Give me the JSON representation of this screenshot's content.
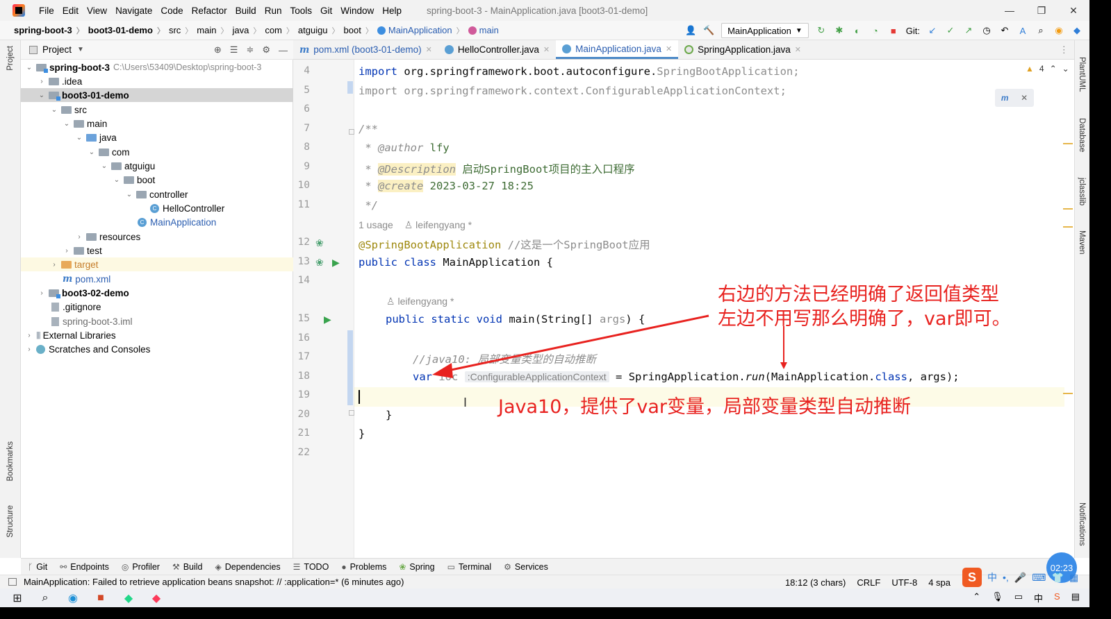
{
  "menu": {
    "items": [
      "File",
      "Edit",
      "View",
      "Navigate",
      "Code",
      "Refactor",
      "Build",
      "Run",
      "Tools",
      "Git",
      "Window",
      "Help"
    ],
    "window_title": "spring-boot-3 - MainApplication.java [boot3-01-demo]"
  },
  "window_controls": {
    "minimize": "—",
    "maximize": "❐",
    "close": "✕"
  },
  "breadcrumb": [
    "spring-boot-3",
    "boot3-01-demo",
    "src",
    "main",
    "java",
    "com",
    "atguigu",
    "boot",
    "MainApplication",
    "main"
  ],
  "toolbar": {
    "run_config": "MainApplication",
    "git_label": "Git:"
  },
  "left_strip": {
    "project": "Project",
    "bookmarks": "Bookmarks",
    "structure": "Structure"
  },
  "project_panel": {
    "title": "Project",
    "tree": [
      {
        "label": "spring-boot-3",
        "path": "C:\\Users\\53409\\Desktop\\spring-boot-3"
      },
      {
        "label": ".idea"
      },
      {
        "label": "boot3-01-demo"
      },
      {
        "label": "src"
      },
      {
        "label": "main"
      },
      {
        "label": "java"
      },
      {
        "label": "com"
      },
      {
        "label": "atguigu"
      },
      {
        "label": "boot"
      },
      {
        "label": "controller"
      },
      {
        "label": "HelloController"
      },
      {
        "label": "MainApplication"
      },
      {
        "label": "resources"
      },
      {
        "label": "test"
      },
      {
        "label": "target"
      },
      {
        "label": "pom.xml"
      },
      {
        "label": "boot3-02-demo"
      },
      {
        "label": ".gitignore"
      },
      {
        "label": "spring-boot-3.iml"
      },
      {
        "label": "External Libraries"
      },
      {
        "label": "Scratches and Consoles"
      }
    ]
  },
  "tabs": [
    {
      "label": "pom.xml (boot3-01-demo)"
    },
    {
      "label": "HelloController.java"
    },
    {
      "label": "MainApplication.java"
    },
    {
      "label": "SpringApplication.java"
    }
  ],
  "editor": {
    "line_numbers": [
      "4",
      "5",
      "6",
      "7",
      "8",
      "9",
      "10",
      "11",
      "12",
      "13",
      "14",
      "15",
      "16",
      "17",
      "18",
      "19",
      "20",
      "21",
      "22"
    ],
    "import1_kw": "import",
    "import1_pkg": " org.springframework.boot.autoconfigure.",
    "import1_cls": "SpringBootApplication;",
    "import2": "import org.springframework.context.ConfigurableApplicationContext;",
    "jd_open": "/**",
    "jd_star": " * ",
    "jd_author_tag": "@author",
    "jd_author_val": " lfy",
    "jd_desc_tag": "@Description",
    "jd_desc_val": " 启动SpringBoot项目的主入口程序",
    "jd_create_tag": "@create",
    "jd_create_val": " 2023-03-27 18:25",
    "jd_close": " */",
    "usage_meta": "1 usage",
    "author_meta": "leifengyang *",
    "annotation": "@SpringBootApplication",
    "annotation_comment": " //这是一个SpringBoot应用",
    "class_kw": "public class",
    "class_name": " MainApplication {",
    "method_author_meta": "leifengyang *",
    "method_kw": "public static void",
    "method_sig": " main(String[] ",
    "method_args": "args",
    "method_end": ") {",
    "comment_java10": "//java10: 局部变量类型的自动推断",
    "var_kw": "var",
    "var_name": "ioc",
    "type_hint": ":ConfigurableApplicationContext",
    "assign": " = SpringApplication.",
    "run_call": "run",
    "run_args_a": "(MainApplication.",
    "class_kw2": "class",
    "run_args_b": ", args);",
    "close_method": "}",
    "close_class": "}"
  },
  "annotations": {
    "line1": "右边的方法已经明确了返回值类型",
    "line2": "左边不用写那么明确了，var即可。",
    "line3": "Java10，提供了var变量，局部变量类型自动推断",
    "color": "#e8221f"
  },
  "warnings": {
    "count": "4"
  },
  "right_strip": {
    "plantuml": "PlantUML",
    "database": "Database",
    "jclasslib": "jclasslib",
    "maven": "Maven",
    "notifications": "Notifications"
  },
  "bottom_tools": [
    "Git",
    "Endpoints",
    "Profiler",
    "Build",
    "Dependencies",
    "TODO",
    "Problems",
    "Spring",
    "Terminal",
    "Services"
  ],
  "status": {
    "message": "MainApplication: Failed to retrieve application beans snapshot: // :application=* (6 minutes ago)",
    "position": "18:12 (3 chars)",
    "line_sep": "CRLF",
    "encoding": "UTF-8",
    "indent": "4 spa"
  },
  "timer": "02:23",
  "ime": {
    "lang": "中"
  }
}
